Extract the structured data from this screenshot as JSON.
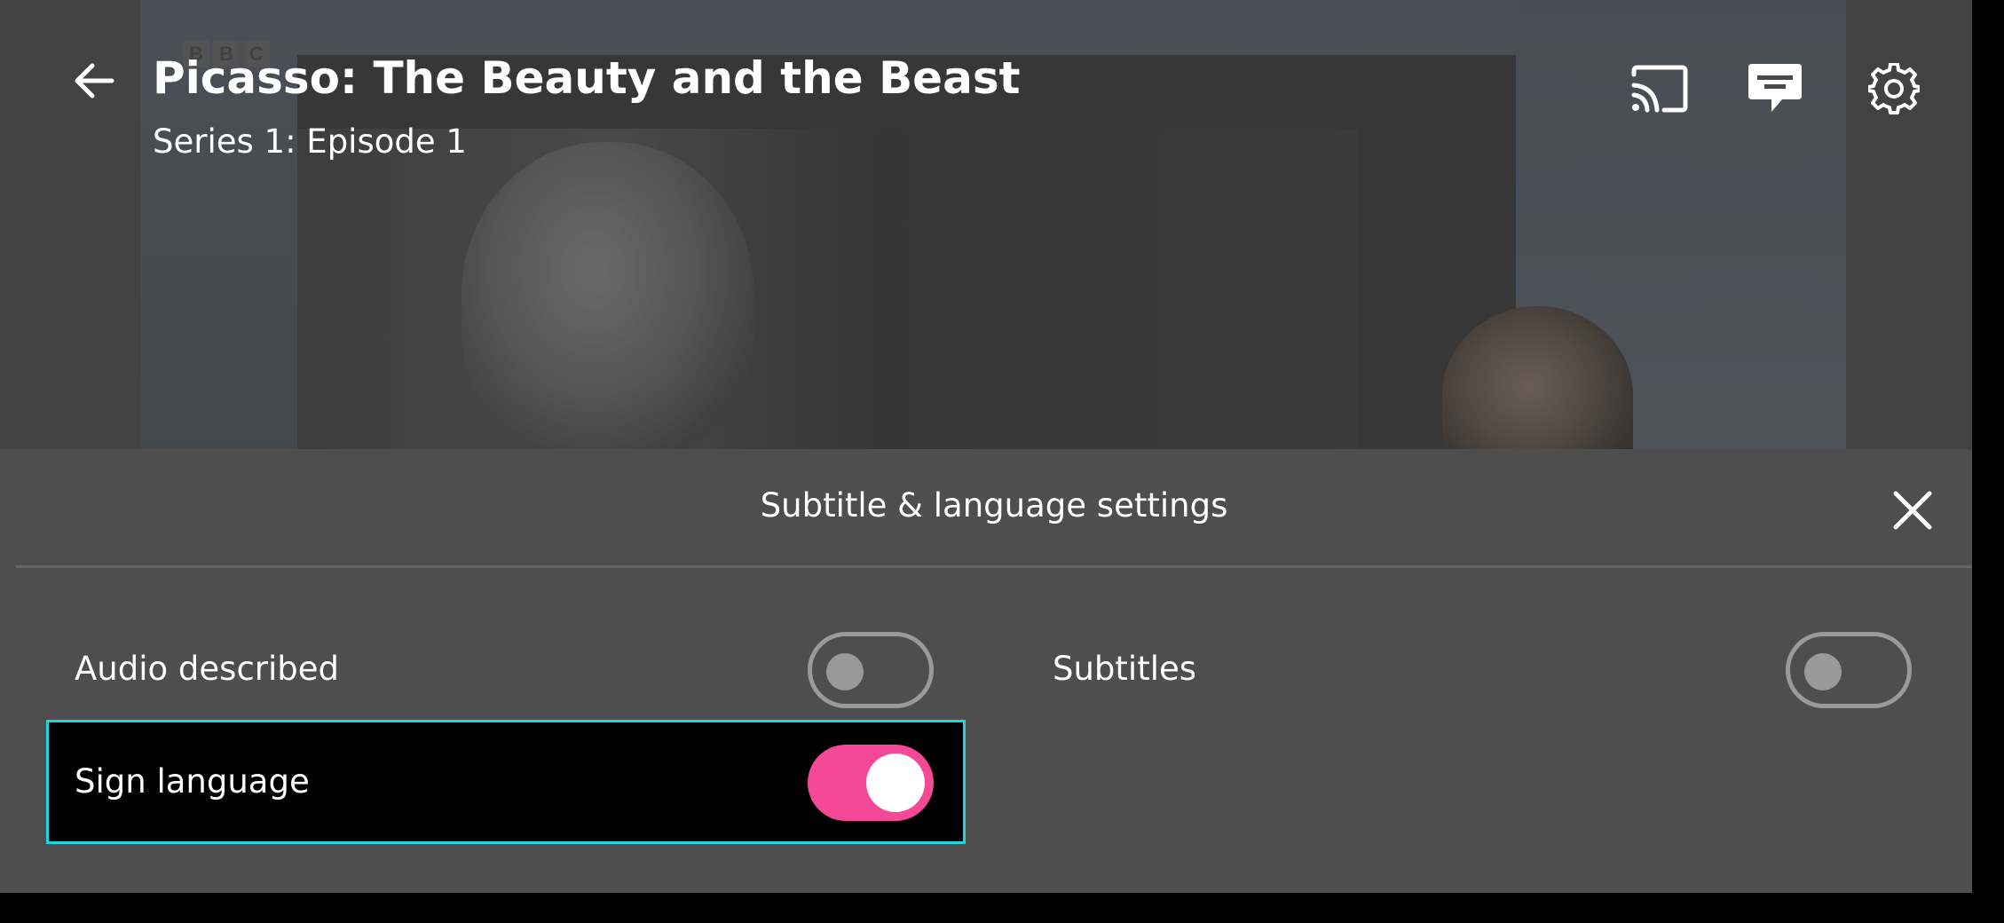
{
  "player": {
    "title": "Picasso: The Beauty and the Beast",
    "subtitle": "Series 1: Episode 1",
    "channel_logo_letters": [
      "B",
      "B",
      "C"
    ],
    "icons": {
      "back": "arrow-left-icon",
      "cast": "cast-icon",
      "subtitles": "subtitles-speech-bubble-icon",
      "settings": "gear-icon"
    }
  },
  "settings_panel": {
    "title": "Subtitle & language settings",
    "close_icon": "close-icon",
    "options": [
      {
        "label": "Audio described",
        "enabled": false
      },
      {
        "label": "Subtitles",
        "enabled": false
      },
      {
        "label": "Sign language",
        "enabled": true,
        "focused": true
      }
    ]
  },
  "colors": {
    "toggle_on": "#f54997",
    "toggle_off_outline": "#9a9a9a",
    "focus_outline": "#1fd6e0",
    "panel_background": "#4e4e4e"
  }
}
